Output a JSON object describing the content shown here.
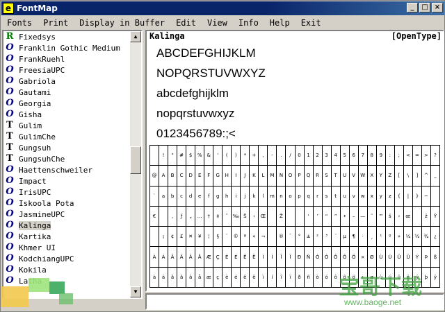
{
  "window": {
    "title": "FontMap",
    "app_icon": "e"
  },
  "title_buttons": {
    "minimize": "_",
    "maximize": "□",
    "close": "×"
  },
  "menu": [
    {
      "label": "Fonts",
      "key": "F"
    },
    {
      "label": "Print",
      "key": "P"
    },
    {
      "label": "Display in Buffer",
      "key": "D"
    },
    {
      "label": "Edit",
      "key": "E"
    },
    {
      "label": "View",
      "key": "V"
    },
    {
      "label": "Info",
      "key": "I"
    },
    {
      "label": "Help",
      "key": "H"
    },
    {
      "label": "Exit",
      "key": "x"
    }
  ],
  "fonts": [
    {
      "name": "Fixedsys",
      "type": "raster",
      "glyph": "R"
    },
    {
      "name": "Franklin Gothic Medium",
      "type": "opentype",
      "glyph": "O"
    },
    {
      "name": "FrankRuehl",
      "type": "opentype",
      "glyph": "O"
    },
    {
      "name": "FreesiaUPC",
      "type": "opentype",
      "glyph": "O"
    },
    {
      "name": "Gabriola",
      "type": "opentype",
      "glyph": "O"
    },
    {
      "name": "Gautami",
      "type": "opentype",
      "glyph": "O"
    },
    {
      "name": "Georgia",
      "type": "opentype",
      "glyph": "O"
    },
    {
      "name": "Gisha",
      "type": "opentype",
      "glyph": "O"
    },
    {
      "name": "Gulim",
      "type": "truetype",
      "glyph": "T"
    },
    {
      "name": "GulimChe",
      "type": "truetype",
      "glyph": "T"
    },
    {
      "name": "Gungsuh",
      "type": "truetype",
      "glyph": "T"
    },
    {
      "name": "GungsuhChe",
      "type": "truetype",
      "glyph": "T"
    },
    {
      "name": "Haettenschweiler",
      "type": "opentype",
      "glyph": "O"
    },
    {
      "name": "Impact",
      "type": "opentype",
      "glyph": "O"
    },
    {
      "name": "IrisUPC",
      "type": "opentype",
      "glyph": "O"
    },
    {
      "name": "Iskoola Pota",
      "type": "opentype",
      "glyph": "O"
    },
    {
      "name": "JasmineUPC",
      "type": "opentype",
      "glyph": "O"
    },
    {
      "name": "Kalinga",
      "type": "opentype",
      "glyph": "O",
      "selected": true
    },
    {
      "name": "Kartika",
      "type": "opentype",
      "glyph": "O"
    },
    {
      "name": "Khmer UI",
      "type": "opentype",
      "glyph": "O"
    },
    {
      "name": "KodchiangUPC",
      "type": "opentype",
      "glyph": "O"
    },
    {
      "name": "Kokila",
      "type": "opentype",
      "glyph": "O"
    },
    {
      "name": "Latha",
      "type": "opentype",
      "glyph": "O"
    }
  ],
  "preview": {
    "font_name": "Kalinga",
    "font_type": "[OpenType]",
    "samples": [
      "ABCDEFGHIJKLM",
      "NOPQRSTUVWXYZ",
      "abcdefghijklm",
      "nopqrstuvwxyz",
      "0123456789:;<"
    ]
  },
  "char_rows": [
    [
      "",
      "!",
      "\"",
      "#",
      "$",
      "%",
      "&",
      "'",
      "(",
      ")",
      "*",
      "+",
      ",",
      "-",
      ".",
      "/",
      "0",
      "1",
      "2",
      "3",
      "4",
      "5",
      "6",
      "7",
      "8",
      "9",
      ":",
      ";",
      "<",
      "=",
      ">",
      "?"
    ],
    [
      "@",
      "A",
      "B",
      "C",
      "D",
      "E",
      "F",
      "G",
      "H",
      "I",
      "J",
      "K",
      "L",
      "M",
      "N",
      "O",
      "P",
      "Q",
      "R",
      "S",
      "T",
      "U",
      "V",
      "W",
      "X",
      "Y",
      "Z",
      "[",
      "\\",
      "]",
      "^",
      "_"
    ],
    [
      "`",
      "a",
      "b",
      "c",
      "d",
      "e",
      "f",
      "g",
      "h",
      "i",
      "j",
      "k",
      "l",
      "m",
      "n",
      "o",
      "p",
      "q",
      "r",
      "s",
      "t",
      "u",
      "v",
      "w",
      "x",
      "y",
      "z",
      "{",
      "|",
      "}",
      "~",
      ""
    ],
    [
      "€",
      "",
      "‚",
      "ƒ",
      "„",
      "…",
      "†",
      "‡",
      "ˆ",
      "‰",
      "Š",
      "‹",
      "Œ",
      "",
      "Ž",
      "",
      "",
      "‘",
      "’",
      "“",
      "”",
      "•",
      "–",
      "—",
      "˜",
      "™",
      "š",
      "›",
      "œ",
      "",
      "ž",
      "Ÿ"
    ],
    [
      "",
      "¡",
      "¢",
      "£",
      "¤",
      "¥",
      "¦",
      "§",
      "¨",
      "©",
      "ª",
      "«",
      "¬",
      "",
      "®",
      "¯",
      "°",
      "±",
      "²",
      "³",
      "´",
      "µ",
      "¶",
      "·",
      "¸",
      "¹",
      "º",
      "»",
      "¼",
      "½",
      "¾",
      "¿"
    ],
    [
      "À",
      "Á",
      "Â",
      "Ã",
      "Ä",
      "Å",
      "Æ",
      "Ç",
      "È",
      "É",
      "Ê",
      "Ë",
      "Ì",
      "Í",
      "Î",
      "Ï",
      "Ð",
      "Ñ",
      "Ò",
      "Ó",
      "Ô",
      "Õ",
      "Ö",
      "×",
      "Ø",
      "Ù",
      "Ú",
      "Û",
      "Ü",
      "Ý",
      "Þ",
      "ß"
    ],
    [
      "à",
      "á",
      "â",
      "ã",
      "ä",
      "å",
      "æ",
      "ç",
      "è",
      "é",
      "ê",
      "ë",
      "ì",
      "í",
      "î",
      "ï",
      "ð",
      "ñ",
      "ò",
      "ó",
      "ô",
      "õ",
      "ö",
      "÷",
      "ø",
      "ù",
      "ú",
      "û",
      "ü",
      "ý",
      "þ",
      "ÿ"
    ]
  ],
  "buffer": {
    "value": ""
  },
  "watermark": {
    "text": "宝哥下载",
    "url": "www.baoge.net"
  }
}
